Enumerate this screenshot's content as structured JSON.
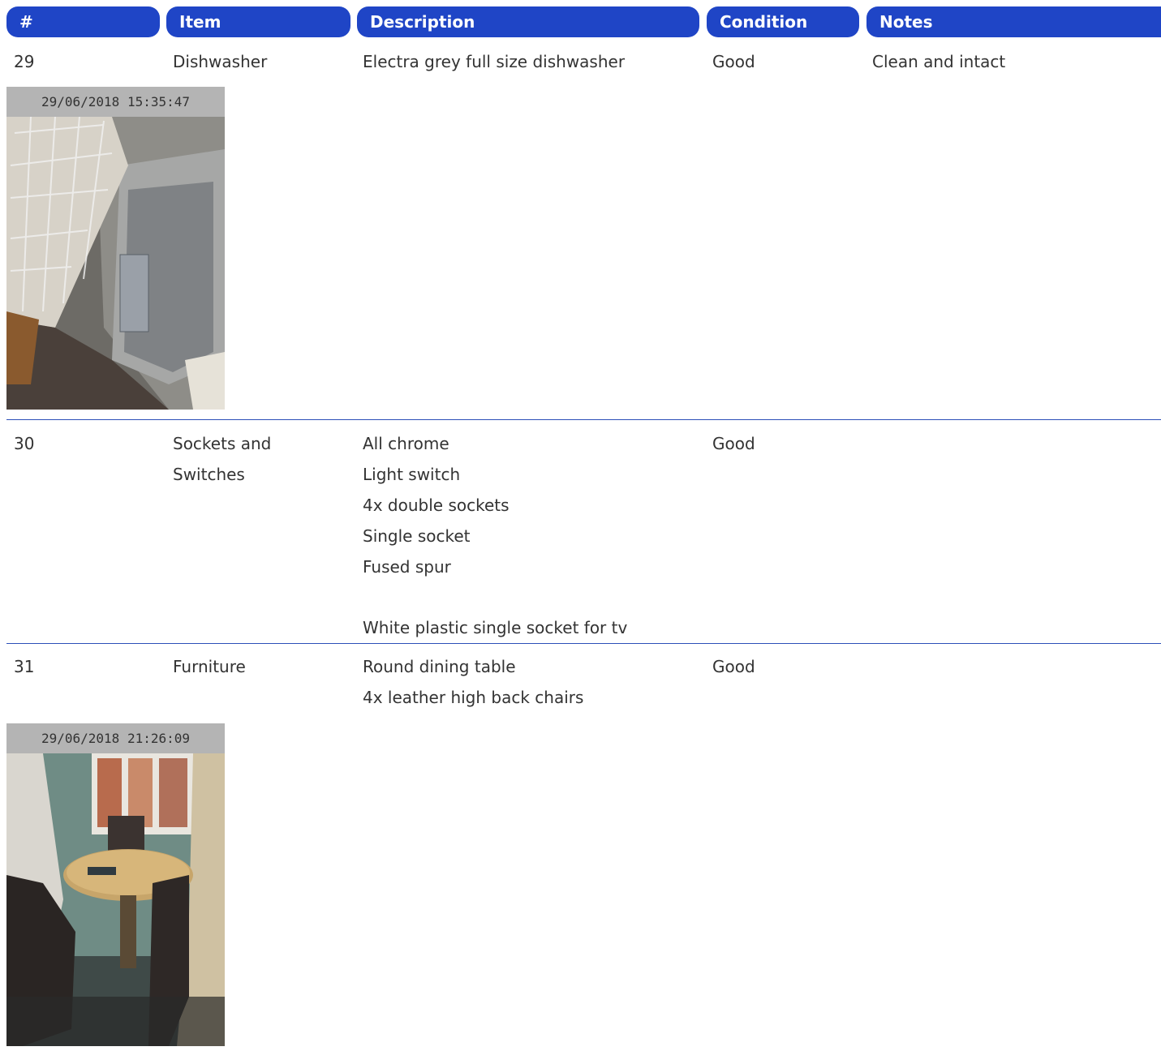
{
  "header": {
    "columns": [
      "#",
      "Item",
      "Description",
      "Condition",
      "Notes"
    ]
  },
  "rows": [
    {
      "number": "29",
      "item_lines": [
        "Dishwasher"
      ],
      "description_lines": [
        "Electra grey full size dishwasher"
      ],
      "condition": "Good",
      "notes": "Clean and intact",
      "photo": {
        "timestamp": "29/06/2018 15:35:47",
        "subject": "dishwasher-interior"
      }
    },
    {
      "number": "30",
      "item_lines": [
        "Sockets and",
        "Switches"
      ],
      "description_lines": [
        "All chrome",
        "Light switch",
        "4x double sockets",
        "Single socket",
        "Fused spur",
        "",
        "White plastic single socket for tv"
      ],
      "condition": "Good",
      "notes": ""
    },
    {
      "number": "31",
      "item_lines": [
        "Furniture"
      ],
      "description_lines": [
        "Round dining table",
        "4x leather high back chairs"
      ],
      "condition": "Good",
      "notes": "",
      "photo": {
        "timestamp": "29/06/2018 21:26:09",
        "subject": "dining-table-and-chairs"
      }
    }
  ],
  "colors": {
    "header_bg": "#1f45c6",
    "header_text": "#ffffff",
    "divider": "#2b4fb8",
    "body_text": "#333333",
    "stamp_bg": "#b4b4b4"
  }
}
